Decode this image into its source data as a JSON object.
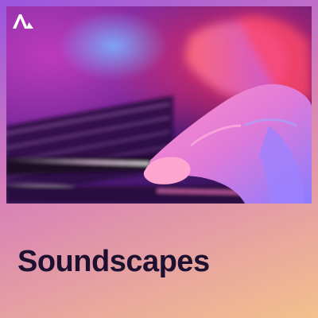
{
  "cover": {
    "title": "Soundscapes",
    "logo_icon": "amazon-music-logo-icon",
    "photo_icon": "piano-hands-photo-icon",
    "colors": {
      "background_top": "#9a55e0",
      "background_mid": "#d77fb8",
      "background_bottom": "#f3c08c",
      "title": "#1e1030",
      "logo": "#ffffff"
    }
  }
}
